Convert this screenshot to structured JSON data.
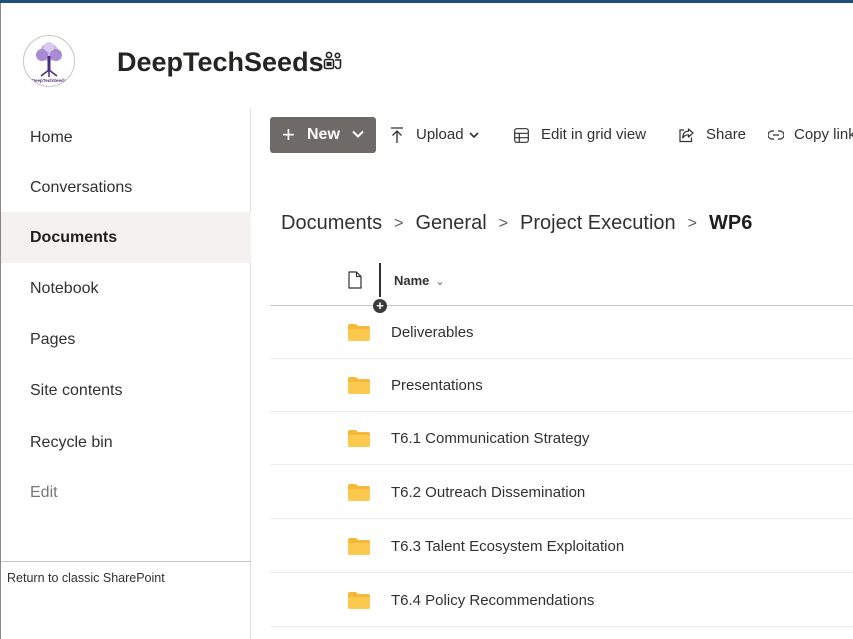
{
  "site": {
    "title": "DeepTechSeeds",
    "logo_icon": "tree-logo-icon",
    "logo_caption": "DeepTechSeeds",
    "teams_icon": "teams-group-icon"
  },
  "sidebar": {
    "items": [
      {
        "label": "Home",
        "selected": false
      },
      {
        "label": "Conversations",
        "selected": false
      },
      {
        "label": "Documents",
        "selected": true
      },
      {
        "label": "Notebook",
        "selected": false
      },
      {
        "label": "Pages",
        "selected": false
      },
      {
        "label": "Site contents",
        "selected": false
      },
      {
        "label": "Recycle bin",
        "selected": false
      },
      {
        "label": "Edit",
        "selected": false
      }
    ],
    "classic_link": "Return to classic SharePoint"
  },
  "toolbar": {
    "new_label": "New",
    "upload_label": "Upload",
    "grid_label": "Edit in grid view",
    "share_label": "Share",
    "copy_link_label": "Copy link"
  },
  "breadcrumb": {
    "items": [
      "Documents",
      "General",
      "Project Execution"
    ],
    "current": "WP6"
  },
  "list": {
    "name_header": "Name",
    "rows": [
      {
        "name": "Deliverables"
      },
      {
        "name": "Presentations"
      },
      {
        "name": "T6.1 Communication Strategy"
      },
      {
        "name": "T6.2 Outreach Dissemination"
      },
      {
        "name": "T6.3 Talent Ecosystem Exploitation"
      },
      {
        "name": "T6.4 Policy Recommendations"
      }
    ]
  },
  "colors": {
    "folder": "#f4b83a",
    "new_button": "#6e6a67",
    "selected_nav": "#f3f2f1"
  }
}
